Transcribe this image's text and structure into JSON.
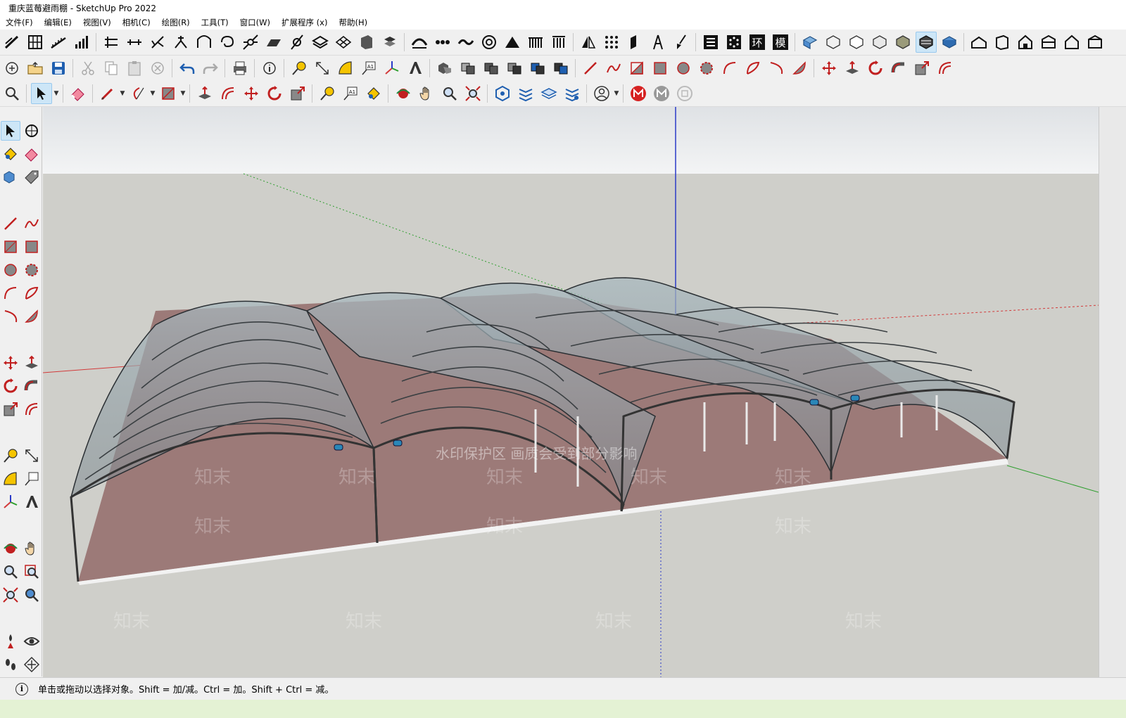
{
  "window": {
    "title": "重庆蓝莓避雨棚 - SketchUp Pro 2022"
  },
  "menu": [
    "文件(F)",
    "编辑(E)",
    "视图(V)",
    "相机(C)",
    "绘图(R)",
    "工具(T)",
    "窗口(W)",
    "扩展程序 (x)",
    "帮助(H)"
  ],
  "statusbar": {
    "info_icon": "i",
    "hint": "单击或拖动以选择对象。Shift = 加/减。Ctrl = 加。Shift + Ctrl = 减。"
  },
  "watermark": {
    "banner": "水印保护区   画质会受到部分影响",
    "brand": "知末"
  },
  "toolbar_row1_special": [
    "环",
    "模"
  ],
  "colors": {
    "sky_top": "#e6e8ea",
    "ground": "#cfcfca",
    "floor": "#9c7a78",
    "axis_red": "#d23a3a",
    "axis_green": "#2e9e2e",
    "axis_blue": "#2a3ac8",
    "select_blue": "#cde6f7"
  }
}
